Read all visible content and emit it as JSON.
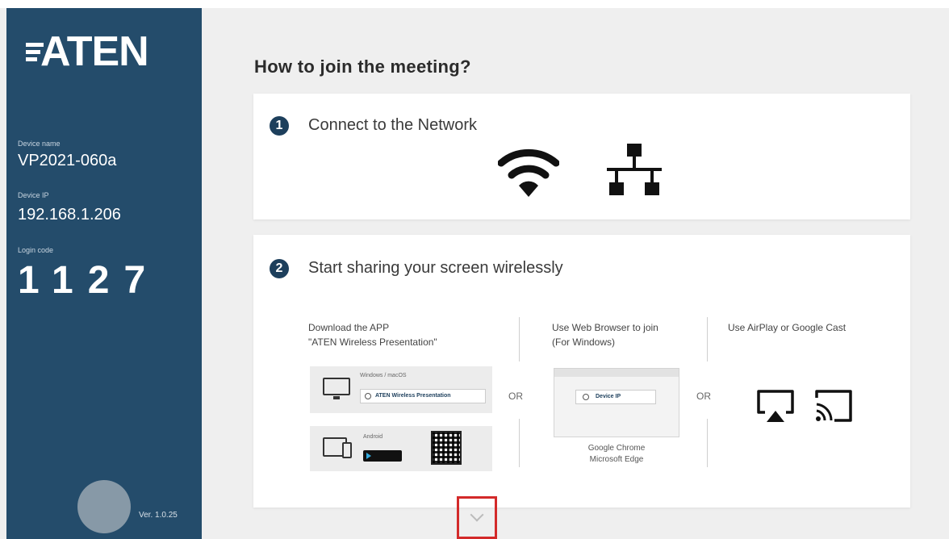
{
  "sidebar": {
    "logo": "ATEN",
    "device_name_label": "Device name",
    "device_name": "VP2021-060a",
    "device_ip_label": "Device IP",
    "device_ip": "192.168.1.206",
    "login_code_label": "Login code",
    "login_code": "1127",
    "version": "Ver. 1.0.25"
  },
  "main": {
    "title": "How to join the meeting?",
    "step1": {
      "number": "1",
      "title": "Connect to the Network",
      "icons": [
        "wifi-icon",
        "lan-icon"
      ]
    },
    "step2": {
      "number": "2",
      "title": "Start sharing your screen wirelessly",
      "app": {
        "title": "Download the APP",
        "subtitle": "\"ATEN Wireless Presentation\"",
        "windows_label": "Windows / macOS",
        "search_text": "ATEN Wireless Presentation",
        "android_label": "Android"
      },
      "or": "OR",
      "browser": {
        "title": "Use Web Browser to join",
        "subtitle": "(For Windows)",
        "search_text": "Device IP",
        "caption_line1": "Google Chrome",
        "caption_line2": "Microsoft Edge"
      },
      "cast": {
        "title": "Use AirPlay or Google Cast",
        "icons": [
          "airplay-icon",
          "cast-icon"
        ]
      }
    }
  },
  "colors": {
    "sidebar_bg": "#244c6b",
    "step_badge": "#1d3f5c",
    "highlight_box": "#d32a2a"
  }
}
